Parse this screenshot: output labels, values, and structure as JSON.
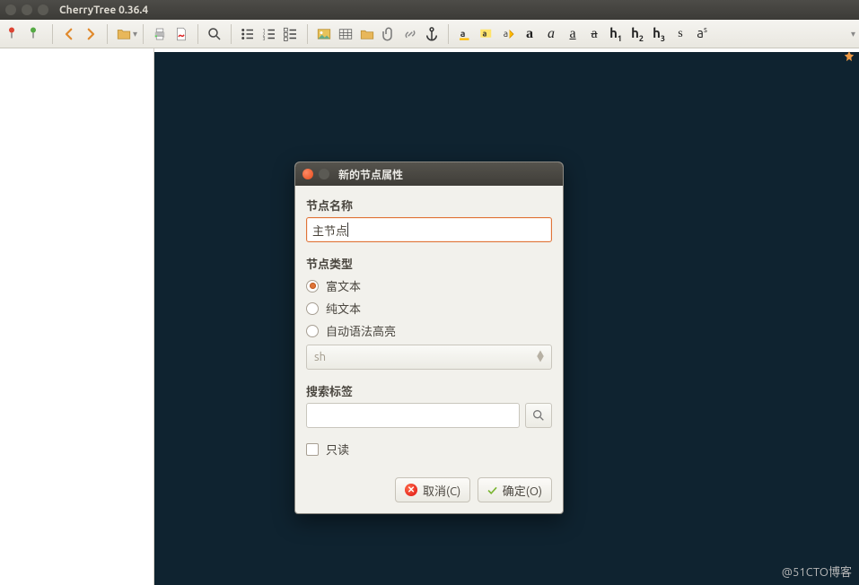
{
  "titlebar": {
    "title": "CherryTree 0.36.4"
  },
  "toolbar": {
    "icons": [
      {
        "name": "node-red-icon"
      },
      {
        "name": "node-green-icon"
      },
      {
        "name": "sep"
      },
      {
        "name": "nav-back-icon"
      },
      {
        "name": "nav-forward-icon"
      },
      {
        "name": "sep"
      },
      {
        "name": "open-folder-icon"
      },
      {
        "name": "dropdown-icon"
      },
      {
        "name": "sep"
      },
      {
        "name": "print-icon"
      },
      {
        "name": "export-pdf-icon"
      },
      {
        "name": "sep"
      },
      {
        "name": "search-icon"
      },
      {
        "name": "sep"
      },
      {
        "name": "list-bulleted-icon"
      },
      {
        "name": "list-numbered-icon"
      },
      {
        "name": "list-todo-icon"
      },
      {
        "name": "sep"
      },
      {
        "name": "insert-image-icon"
      },
      {
        "name": "insert-table-icon"
      },
      {
        "name": "insert-codebox-icon"
      },
      {
        "name": "insert-file-icon"
      },
      {
        "name": "insert-link-icon"
      },
      {
        "name": "insert-anchor-icon"
      },
      {
        "name": "sep"
      },
      {
        "name": "format-color-icon"
      },
      {
        "name": "format-highlight-icon"
      },
      {
        "name": "format-clear-icon"
      },
      {
        "name": "format-bold-icon"
      },
      {
        "name": "format-italic-icon"
      },
      {
        "name": "format-underline-icon"
      },
      {
        "name": "format-strike-icon"
      },
      {
        "name": "heading1-icon"
      },
      {
        "name": "heading2-icon"
      },
      {
        "name": "heading3-icon"
      },
      {
        "name": "format-small-icon"
      },
      {
        "name": "format-superscript-icon"
      }
    ],
    "labels": {
      "h1": "h",
      "h1s": "1",
      "h2": "h",
      "h2s": "2",
      "h3": "h",
      "h3s": "3",
      "bold": "a",
      "italic": "a",
      "underline": "a",
      "strike": "a",
      "small": "s",
      "super": "a",
      "superS": "s"
    }
  },
  "dialog": {
    "title": "新的节点属性",
    "name_label": "节点名称",
    "name_value": "主节点",
    "type_label": "节点类型",
    "type_opts": {
      "rich": "富文本",
      "plain": "纯文本",
      "auto": "自动语法高亮"
    },
    "type_selected": "rich",
    "syntax_combo": "sh",
    "search_label": "搜索标签",
    "search_value": "",
    "readonly_label": "只读",
    "readonly_checked": false,
    "cancel": "取消(C)",
    "ok": "确定(O)"
  },
  "watermark": "@51CTO博客"
}
